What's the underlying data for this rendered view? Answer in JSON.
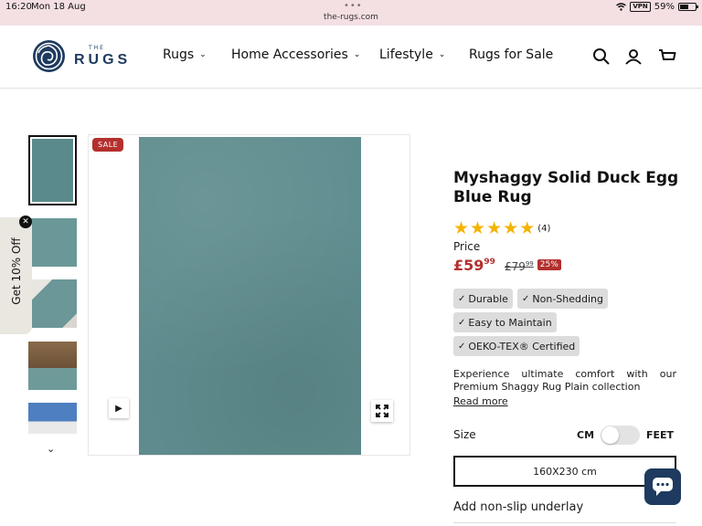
{
  "status": {
    "time": "16:20",
    "date": "Mon 18 Aug",
    "url": "the-rugs.com",
    "vpn": "VPN",
    "battery": "59%",
    "battery_level": 0.59
  },
  "header": {
    "logo_small": "THE",
    "logo_big": "RUGS",
    "nav": [
      {
        "label": "Rugs",
        "dropdown": true
      },
      {
        "label": "Home Accessories",
        "dropdown": true
      },
      {
        "label": "Lifestyle",
        "dropdown": true
      },
      {
        "label": "Rugs for Sale",
        "dropdown": false
      }
    ],
    "icons": [
      "search-icon",
      "account-icon",
      "cart-icon"
    ]
  },
  "gallery": {
    "thumbnails": [
      "thumbnail-1",
      "thumbnail-2",
      "thumbnail-3",
      "thumbnail-4",
      "thumbnail-5"
    ],
    "sale_badge": "SALE",
    "rug_color": "#5f8d8f"
  },
  "promo": {
    "label": "Get 10% Off"
  },
  "product": {
    "title": "Myshaggy Solid Duck Egg Blue Rug",
    "rating": 5,
    "review_count": "(4)",
    "price_label": "Price",
    "price_now_main": "£59",
    "price_now_pence": "99",
    "price_was_main": "£79",
    "price_was_pence": "99",
    "discount": "25%",
    "features": [
      "Durable",
      "Non-Shedding",
      "Easy to Maintain",
      "OEKO-TEX® Certified"
    ],
    "description": "Experience ultimate comfort with our Premium Shaggy Rug Plain collection",
    "read_more": "Read more",
    "size_label": "Size",
    "unit_cm": "CM",
    "unit_feet": "FEET",
    "selected_size": "160X230 cm",
    "underlay_label": "Add non-slip underlay"
  },
  "colors": {
    "accent": "#b3302e",
    "brand": "#1e3a5f",
    "star": "#f4b400",
    "tag_bg": "#dcdcdc"
  }
}
